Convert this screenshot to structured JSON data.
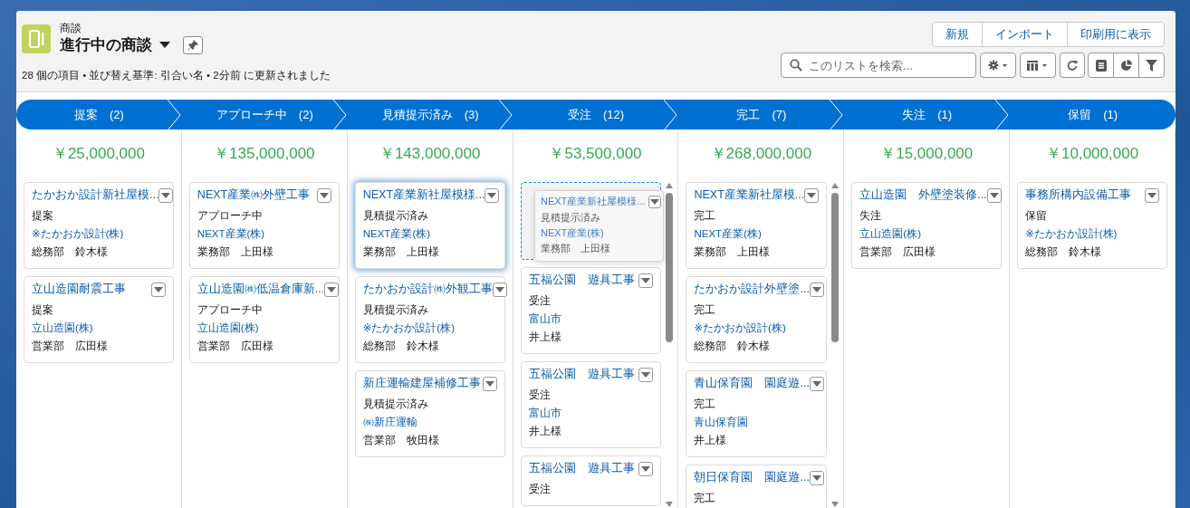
{
  "header": {
    "object_label": "商談",
    "list_title": "進行中の商談",
    "meta": "28 個の項目 • 並び替え基準: 引合い名 • 2分前 に更新されました",
    "actions": [
      "新規",
      "インポート",
      "印刷用に表示"
    ],
    "search": {
      "placeholder": "このリストを検索..."
    }
  },
  "columns": [
    {
      "label": "提案",
      "count": "(2)",
      "amount": "￥25,000,000",
      "scrollable": false,
      "drop_target": false,
      "cards": [
        {
          "title": "たかおか設計新社屋模...",
          "stage": "提案",
          "account": "※たかおか設計(株)",
          "contact": "総務部　鈴木様",
          "selected": false
        },
        {
          "title": "立山造園耐震工事",
          "stage": "提案",
          "account": "立山造園(株)",
          "contact": "営業部　広田様",
          "selected": false
        }
      ]
    },
    {
      "label": "アプローチ中",
      "count": "(2)",
      "amount": "￥135,000,000",
      "scrollable": false,
      "drop_target": false,
      "cards": [
        {
          "title": "NEXT産業㈱外壁工事",
          "stage": "アプローチ中",
          "account": "NEXT産業(株)",
          "contact": "業務部　上田様",
          "selected": false
        },
        {
          "title": "立山造園㈱低温倉庫新...",
          "stage": "アプローチ中",
          "account": "立山造園(株)",
          "contact": "営業部　広田様",
          "selected": false
        }
      ]
    },
    {
      "label": "見積提示済み",
      "count": "(3)",
      "amount": "￥143,000,000",
      "scrollable": false,
      "drop_target": false,
      "cards": [
        {
          "title": "NEXT産業新社屋模様...",
          "stage": "見積提示済み",
          "account": "NEXT産業(株)",
          "contact": "業務部　上田様",
          "selected": true
        },
        {
          "title": "たかおか設計㈱外観工事",
          "stage": "見積提示済み",
          "account": "※たかおか設計(株)",
          "contact": "総務部　鈴木様",
          "selected": false
        },
        {
          "title": "新庄運輸建屋補修工事",
          "stage": "見積提示済み",
          "account": "㈱新庄運輸",
          "contact": "営業部　牧田様",
          "selected": false
        }
      ]
    },
    {
      "label": "受注",
      "count": "(12)",
      "amount": "￥53,500,000",
      "scrollable": true,
      "drop_target": true,
      "cards": [
        {
          "title": "五福公園　遊具工事",
          "stage": "受注",
          "account": "富山市",
          "contact": "井上様",
          "selected": false
        },
        {
          "title": "五福公園　遊具工事",
          "stage": "受注",
          "account": "富山市",
          "contact": "井上様",
          "selected": false
        },
        {
          "title": "五福公園　遊具工事",
          "stage": "受注",
          "selected": false
        }
      ]
    },
    {
      "label": "完工",
      "count": "(7)",
      "amount": "￥268,000,000",
      "scrollable": true,
      "drop_target": false,
      "cards": [
        {
          "title": "NEXT産業新社屋模...",
          "stage": "完工",
          "account": "NEXT産業(株)",
          "contact": "業務部　上田様",
          "selected": false
        },
        {
          "title": "たかおか設計外壁塗...",
          "stage": "完工",
          "account": "※たかおか設計(株)",
          "contact": "総務部　鈴木様",
          "selected": false
        },
        {
          "title": "青山保育園　園庭遊...",
          "stage": "完工",
          "account": "青山保育園",
          "contact": "井上様",
          "selected": false
        },
        {
          "title": "朝日保育園　園庭遊...",
          "stage": "完工",
          "selected": false
        }
      ]
    },
    {
      "label": "失注",
      "count": "(1)",
      "amount": "￥15,000,000",
      "scrollable": false,
      "drop_target": false,
      "cards": [
        {
          "title": "立山造園　外壁塗装修...",
          "stage": "失注",
          "account": "立山造園(株)",
          "contact": "営業部　広田様",
          "selected": false
        }
      ]
    },
    {
      "label": "保留",
      "count": "(1)",
      "amount": "￥10,000,000",
      "scrollable": false,
      "drop_target": false,
      "cards": [
        {
          "title": "事務所構内設備工事",
          "stage": "保留",
          "account": "※たかおか設計(株)",
          "contact": "総務部　鈴木様",
          "selected": false
        }
      ]
    }
  ],
  "dragged_card": {
    "title": "NEXT産業新社屋模様...",
    "stage": "見積提示済み",
    "account": "NEXT産業(株)",
    "contact": "業務部　上田様"
  }
}
